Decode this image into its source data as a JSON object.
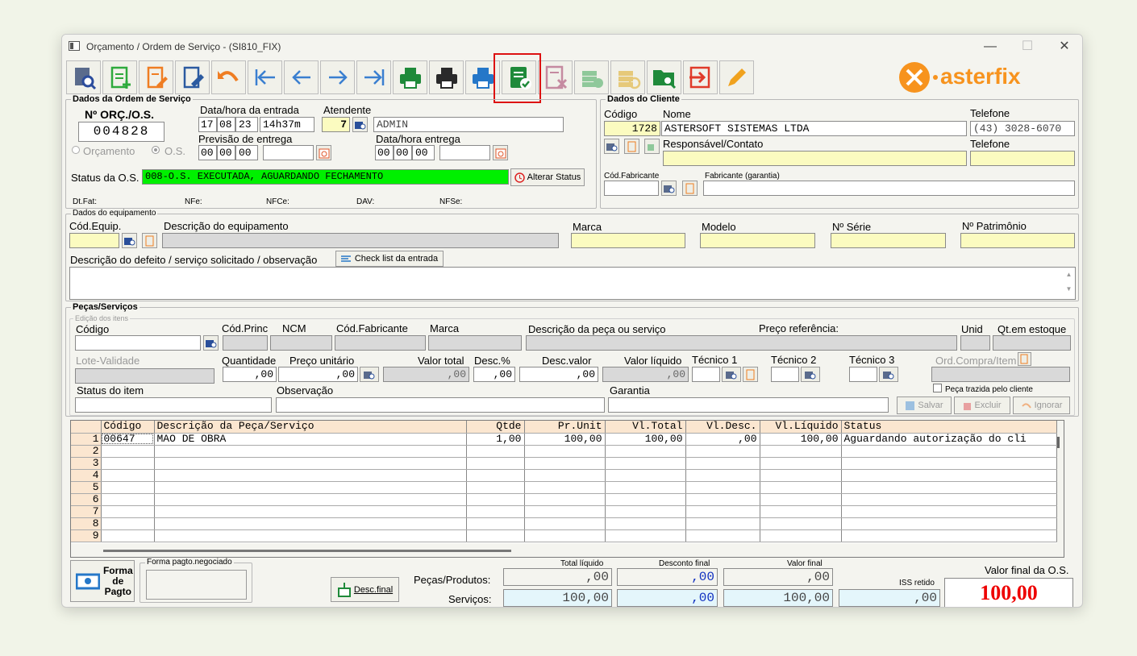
{
  "window": {
    "title": "Orçamento / Ordem de Serviço - (SI810_FIX)",
    "min": "—",
    "max": "☐",
    "close": "✕"
  },
  "logo": {
    "text": "asterfix",
    "color": "#f7931e"
  },
  "toolbar": [
    "search-doc",
    "add-doc",
    "edit-doc",
    "edit-doc-2",
    "undo",
    "first",
    "prev",
    "next",
    "last",
    "print-green",
    "print-black",
    "print-blue",
    "approve-doc",
    "cancel-doc",
    "money-add",
    "money-cancel",
    "folder-search",
    "exit",
    "pencil"
  ],
  "os": {
    "group": "Dados da Ordem de Serviço",
    "no_label": "Nº ORÇ./O.S.",
    "no": "004828",
    "entry_label": "Data/hora da entrada",
    "d1": "17",
    "d2": "08",
    "d3": "23",
    "time": "14h37m",
    "attend_label": "Atendente",
    "attend_code": "7",
    "attend_name": "ADMIN",
    "prev_label": "Previsão de entrega",
    "p1": "00",
    "p2": "00",
    "p3": "00",
    "deliv_label": "Data/hora entrega",
    "e1": "00",
    "e2": "00",
    "e3": "00",
    "opt1": "Orçamento",
    "opt2": "O.S.",
    "status_label": "Status da O.S.",
    "status": "008-O.S. EXECUTADA, AGUARDANDO FECHAMENTO",
    "status_btn": "Alterar Status",
    "dtfat": "Dt.Fat:",
    "nfe": "NFe:",
    "nfce": "NFCe:",
    "dav": "DAV:",
    "nfse": "NFSe:"
  },
  "client": {
    "group": "Dados do Cliente",
    "code_label": "Código",
    "name_label": "Nome",
    "phone_label": "Telefone",
    "code": "1728",
    "name": "ASTERSOFT SISTEMAS LTDA",
    "phone": "(43) 3028-6070",
    "resp_label": "Responsável/Contato",
    "phone2_label": "Telefone",
    "fab_code_label": "Cód.Fabricante",
    "fab_label": "Fabricante (garantia)"
  },
  "equip": {
    "group": "Dados do equipamento",
    "code_label": "Cód.Equip.",
    "desc_label": "Descrição do equipamento",
    "brand_label": "Marca",
    "model_label": "Modelo",
    "serial_label": "Nº Série",
    "patr_label": "Nº Patrimônio",
    "defect_label": "Descrição do defeito / serviço solicitado / observação",
    "checklist": "Check list da entrada"
  },
  "parts": {
    "group": "Peças/Serviços",
    "edit_group": "Edição dos itens",
    "code": "Código",
    "princ": "Cód.Princ",
    "ncm": "NCM",
    "fab": "Cód.Fabricante",
    "brand": "Marca",
    "desc": "Descrição da peça ou serviço",
    "ref": "Preço referência:",
    "unit": "Unid",
    "stock": "Qt.em estoque",
    "lot": "Lote-Validade",
    "qty": "Quantidade",
    "price": "Preço unitário",
    "total": "Valor total",
    "discp": "Desc.%",
    "discv": "Desc.valor",
    "net": "Valor líquido",
    "t1": "Técnico 1",
    "t2": "Técnico 2",
    "t3": "Técnico 3",
    "order": "Ord.Compra/Item",
    "qty_v": ",00",
    "price_v": ",00",
    "total_v": ",00",
    "discp_v": ",00",
    "discv_v": ",00",
    "net_v": ",00",
    "status": "Status do item",
    "obs": "Observação",
    "warranty": "Garantia",
    "brought": "Peça trazida pelo cliente",
    "save": "Salvar",
    "delete": "Excluir",
    "ignore": "Ignorar"
  },
  "grid": {
    "headers": [
      "Código",
      "Descrição da Peça/Serviço",
      "Qtde",
      "Pr.Unit",
      "Vl.Total",
      "Vl.Desc.",
      "Vl.Líquido",
      "Status"
    ],
    "rows": [
      {
        "n": "1",
        "code": "00647",
        "desc": "MAO DE OBRA",
        "qty": "1,00",
        "unit": "100,00",
        "total": "100,00",
        "disc": ",00",
        "net": "100,00",
        "status": "Aguardando autorização do cli"
      },
      {
        "n": "2"
      },
      {
        "n": "3"
      },
      {
        "n": "4"
      },
      {
        "n": "5"
      },
      {
        "n": "6"
      },
      {
        "n": "7"
      },
      {
        "n": "8"
      },
      {
        "n": "9"
      }
    ]
  },
  "footer": {
    "pay_btn": "Forma de Pagto",
    "pay_group": "Forma pagto.negociado",
    "disc_btn": "Desc.final",
    "tot_label": "Total líquido",
    "disc_label": "Desconto final",
    "final_label": "Valor final",
    "parts_label": "Peças/Produtos:",
    "serv_label": "Serviços:",
    "p_tot": ",00",
    "p_disc": ",00",
    "p_final": ",00",
    "s_tot": "100,00",
    "s_disc": ",00",
    "s_final": "100,00",
    "iss_label": "ISS retido",
    "iss": ",00",
    "os_final_label": "Valor final da O.S.",
    "os_final": "100,00"
  }
}
